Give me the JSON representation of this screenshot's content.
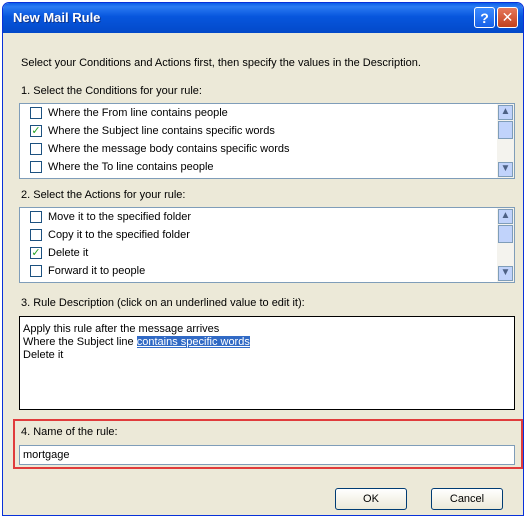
{
  "window": {
    "title": "New Mail Rule"
  },
  "intro_text": "Select your Conditions and Actions first, then specify the values in the Description.",
  "conditions": {
    "label": "1. Select the Conditions for your rule:",
    "items": [
      {
        "label": "Where the From line contains people",
        "checked": false
      },
      {
        "label": "Where the Subject line contains specific words",
        "checked": true
      },
      {
        "label": "Where the message body contains specific words",
        "checked": false
      },
      {
        "label": "Where the To line contains people",
        "checked": false
      }
    ]
  },
  "actions": {
    "label": "2. Select the Actions for your rule:",
    "items": [
      {
        "label": "Move it to the specified folder",
        "checked": false
      },
      {
        "label": "Copy it to the specified folder",
        "checked": false
      },
      {
        "label": "Delete it",
        "checked": true
      },
      {
        "label": "Forward it to people",
        "checked": false
      }
    ]
  },
  "description": {
    "label": "3. Rule Description (click on an underlined value to edit it):",
    "line1": "Apply this rule after the message arrives",
    "line2_prefix": "Where the Subject line ",
    "line2_link": "contains specific words",
    "line3": "Delete it"
  },
  "rule_name": {
    "label": "4. Name of the rule:",
    "value": "mortgage"
  },
  "buttons": {
    "ok": "OK",
    "cancel": "Cancel"
  },
  "colors": {
    "title_bar": "#0a5ee8",
    "highlight_frame": "#e03c3c",
    "link_bg": "#316ac5"
  }
}
